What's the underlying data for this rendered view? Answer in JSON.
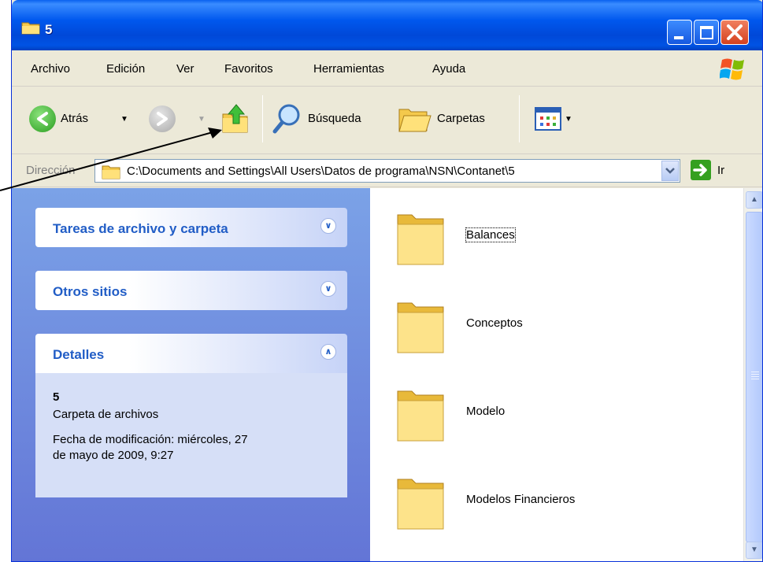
{
  "window": {
    "title": "5"
  },
  "menu": [
    "Archivo",
    "Edición",
    "Ver",
    "Favoritos",
    "Herramientas",
    "Ayuda"
  ],
  "toolbar": {
    "back_label": "Atrás",
    "search_label": "Búsqueda",
    "folders_label": "Carpetas"
  },
  "address": {
    "label": "Dirección",
    "path": "C:\\Documents and Settings\\All Users\\Datos de programa\\NSN\\Contanet\\5",
    "go_label": "Ir"
  },
  "tasks": {
    "file_folder_tasks": "Tareas de archivo y carpeta",
    "other_places": "Otros sitios",
    "details": "Detalles"
  },
  "details": {
    "name": "5",
    "type": "Carpeta de archivos",
    "modified_line1": "Fecha de modificación: miércoles, 27",
    "modified_line2": "de mayo de 2009, 9:27"
  },
  "files": [
    {
      "name": "Balances",
      "selected": true
    },
    {
      "name": "Conceptos"
    },
    {
      "name": "Modelo"
    },
    {
      "name": "Modelos Financieros"
    }
  ],
  "colors": {
    "title_bar": "#0058ee",
    "task_pane": "#7ba2e7",
    "task_title": "#215dc6",
    "folder": "#f5d76e"
  },
  "icons": [
    "folder-icon",
    "back-icon",
    "forward-icon",
    "up-folder-icon",
    "search-icon",
    "folders-icon",
    "views-icon",
    "go-icon",
    "windows-logo-icon"
  ]
}
